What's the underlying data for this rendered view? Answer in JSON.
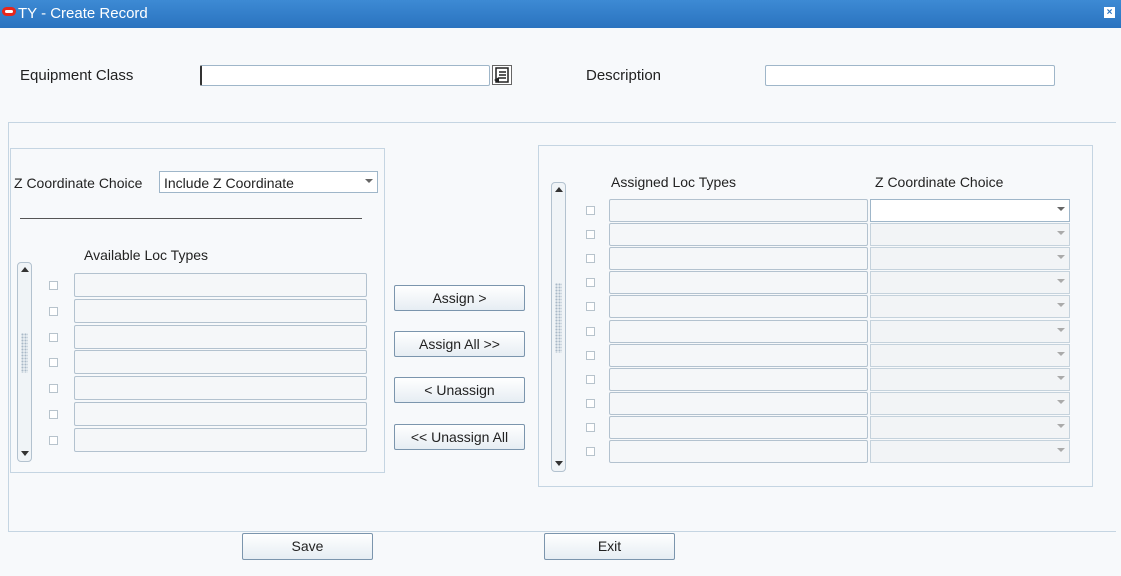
{
  "window": {
    "title": "TY - Create Record",
    "close_glyph": "×",
    "logo_icon": "oracle-logo-icon"
  },
  "header": {
    "equipment_class_label": "Equipment Class",
    "equipment_class_value": "",
    "lov_icon": "list-of-values-icon",
    "description_label": "Description",
    "description_value": ""
  },
  "left_panel": {
    "z_choice_label": "Z Coordinate Choice",
    "z_choice_value": "Include Z Coordinate",
    "available_header": "Available Loc Types",
    "rows": [
      "",
      "",
      "",
      "",
      "",
      "",
      ""
    ]
  },
  "actions": {
    "assign": "Assign >",
    "assign_all": "Assign All >>",
    "unassign": "< Unassign",
    "unassign_all": "<< Unassign All"
  },
  "right_panel": {
    "assigned_header": "Assigned Loc Types",
    "z_choice_header": "Z Coordinate Choice",
    "rows": [
      {
        "loc_type": "",
        "z_choice": ""
      },
      {
        "loc_type": "",
        "z_choice": ""
      },
      {
        "loc_type": "",
        "z_choice": ""
      },
      {
        "loc_type": "",
        "z_choice": ""
      },
      {
        "loc_type": "",
        "z_choice": ""
      },
      {
        "loc_type": "",
        "z_choice": ""
      },
      {
        "loc_type": "",
        "z_choice": ""
      },
      {
        "loc_type": "",
        "z_choice": ""
      },
      {
        "loc_type": "",
        "z_choice": ""
      },
      {
        "loc_type": "",
        "z_choice": ""
      },
      {
        "loc_type": "",
        "z_choice": ""
      }
    ]
  },
  "footer": {
    "save": "Save",
    "exit": "Exit"
  },
  "colors": {
    "titlebar": "#2a73bf",
    "logo": "#e8261b",
    "field_border": "#9fb6c9",
    "panel_border": "#c5d5e2"
  }
}
